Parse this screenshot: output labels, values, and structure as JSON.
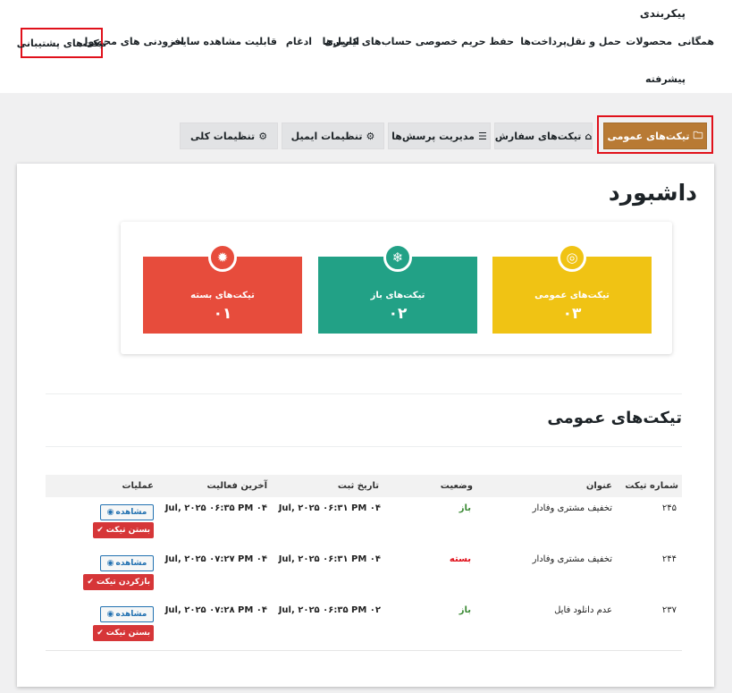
{
  "page_title": "پیکربندی",
  "nav": {
    "items": [
      "همگانی",
      "محصولات",
      "حمل و نقل",
      "پرداخت‌ها",
      "حفظ حریم خصوصی حساب‌های کاربری",
      "ایمیل‌ها",
      "ادغام",
      "قابلیت مشاهده سایت",
      "افزودنی های محصول",
      "تیکت‌های پشتیبانی"
    ],
    "advanced": "پیشرفته",
    "active_index": 9
  },
  "tabs": [
    {
      "label": "تیکت‌های عمومی",
      "icon": "briefcase-icon",
      "glyph": "🗀"
    },
    {
      "label": "تیکت‌های سفارش",
      "icon": "basket-icon",
      "glyph": "⌂"
    },
    {
      "label": "مدیریت پرسش‌ها",
      "icon": "list-icon",
      "glyph": "☰"
    },
    {
      "label": "تنظیمات ایمیل",
      "icon": "gears-icon",
      "glyph": "⚙"
    },
    {
      "label": "تنظیمات کلی",
      "icon": "gears-icon",
      "glyph": "⚙"
    }
  ],
  "dashboard": {
    "title": "داشبورد",
    "stats": [
      {
        "label": "تیکت‌های عمومی",
        "value": "۰۳",
        "color": "#f0c314",
        "icon": "target-icon",
        "glyph": "◎"
      },
      {
        "label": "تیکت‌های باز",
        "value": "۰۲",
        "color": "#22a186",
        "icon": "snowflake-icon",
        "glyph": "❄"
      },
      {
        "label": "تیکت‌های بسته",
        "value": "۰۱",
        "color": "#e74c3c",
        "icon": "gear-icon",
        "glyph": "✹"
      }
    ]
  },
  "tickets": {
    "title": "تیکت‌های عمومی",
    "columns": [
      "شماره تیکت",
      "عنوان",
      "وضعیت",
      "تاریخ ثبت",
      "آخرین فعالیت",
      "عملیات"
    ],
    "rows": [
      {
        "id": "۲۴۵",
        "subject": "تخفیف مشتری وفادار",
        "status": "باز",
        "status_type": "open",
        "created": "Jul, ۲۰۲۵ ۰۶:۳۱ PM ۰۴",
        "last": "Jul, ۲۰۲۵ ۰۶:۳۵ PM ۰۴",
        "view": "مشاهده",
        "action": "بستن تیکت"
      },
      {
        "id": "۲۴۴",
        "subject": "تخفیف مشتری وفادار",
        "status": "بسته",
        "status_type": "closed",
        "created": "Jul, ۲۰۲۵ ۰۶:۳۱ PM ۰۴",
        "last": "Jul, ۲۰۲۵ ۰۷:۲۷ PM ۰۴",
        "view": "مشاهده",
        "action": "بازکردن تیکت"
      },
      {
        "id": "۲۳۷",
        "subject": "عدم دانلود فایل",
        "status": "باز",
        "status_type": "open",
        "created": "Jul, ۲۰۲۵ ۰۶:۳۵ PM ۰۲",
        "last": "Jul, ۲۰۲۵ ۰۷:۲۸ PM ۰۴",
        "view": "مشاهده",
        "action": "بستن تیکت"
      }
    ]
  }
}
